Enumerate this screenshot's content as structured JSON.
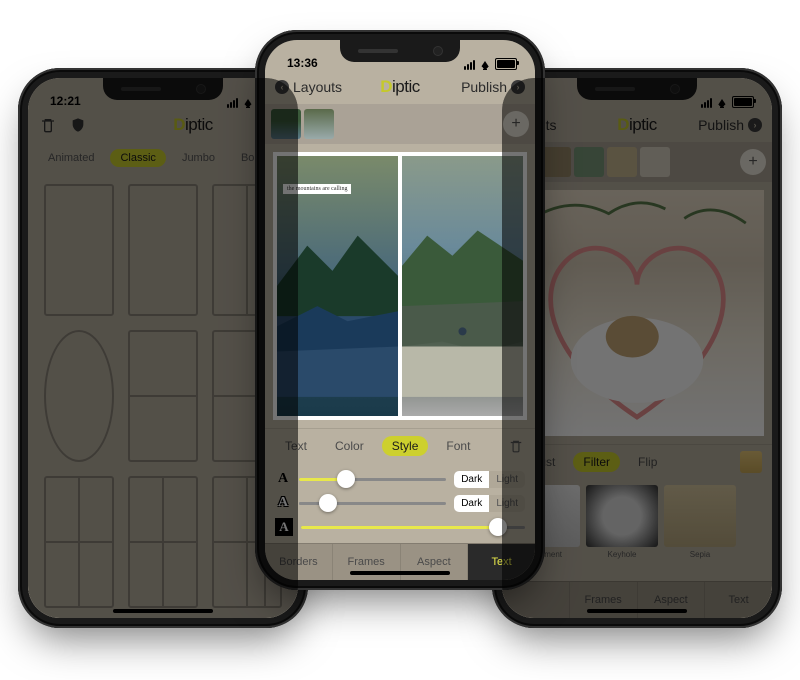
{
  "app_name": "Diptic",
  "left": {
    "time": "12:21",
    "nav": {
      "back": "",
      "publish": ""
    },
    "toolbar_icons": [
      "trash",
      "shield"
    ],
    "categories": [
      "Animated",
      "Classic",
      "Jumbo",
      "Borde"
    ],
    "active_category": "Classic"
  },
  "center": {
    "time": "13:36",
    "nav": {
      "back": "Layouts",
      "publish": "Publish"
    },
    "caption_text": "the mountains are calling",
    "subtabs": [
      "Text",
      "Color",
      "Style",
      "Font"
    ],
    "active_subtab": "Style",
    "sliders": [
      {
        "value_pct": 32,
        "segment": [
          "Dark",
          "Light"
        ],
        "segment_on": "Dark"
      },
      {
        "value_pct": 20,
        "segment": [
          "Dark",
          "Light"
        ],
        "segment_on": "Dark"
      },
      {
        "value_pct": 88,
        "segment": null
      }
    ],
    "bottom_tabs": [
      "Borders",
      "Frames",
      "Aspect",
      "Text"
    ],
    "active_bottom_tab": "Text"
  },
  "right": {
    "time": "",
    "nav": {
      "back": "outs",
      "publish": "Publish"
    },
    "subtabs": [
      "Adjust",
      "Filter",
      "Flip"
    ],
    "active_subtab": "Filter",
    "filters": [
      "Basement",
      "Keyhole",
      "Sepia"
    ],
    "bottom_tabs": [
      "",
      "Frames",
      "Aspect",
      "Text"
    ]
  }
}
